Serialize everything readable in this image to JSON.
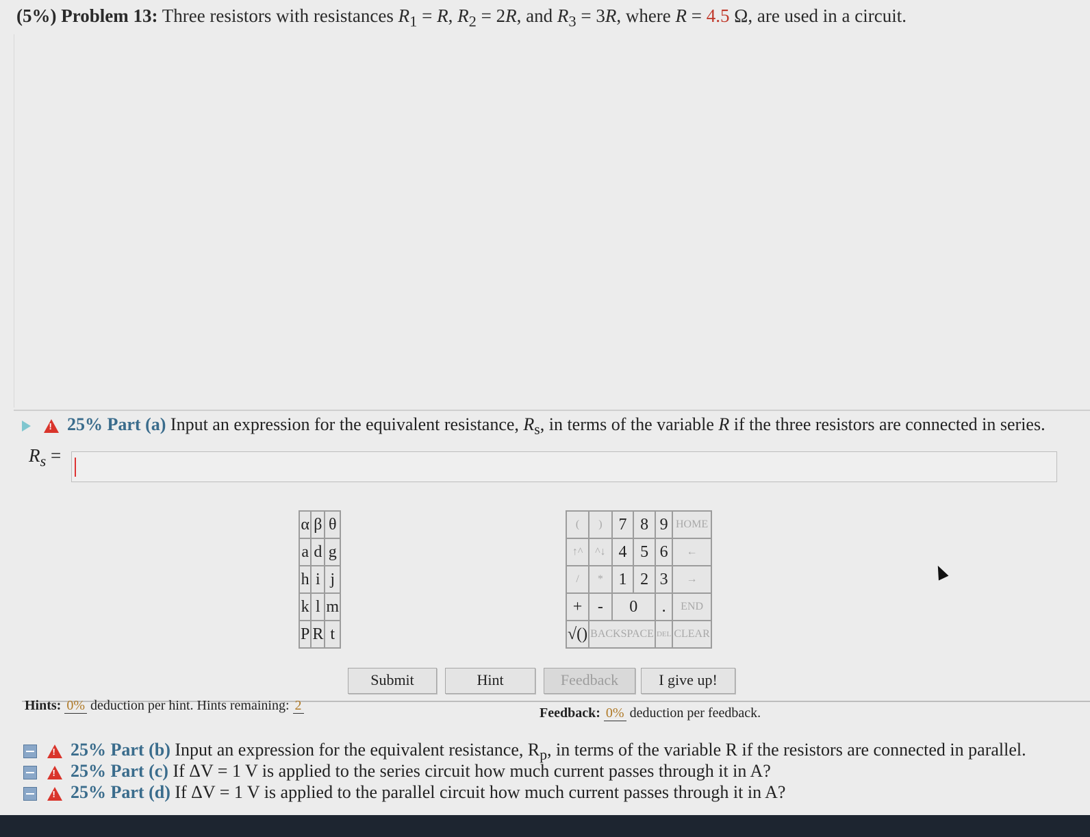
{
  "problem": {
    "pct": "(5%)",
    "title": "Problem 13:",
    "text_a": "Three resistors with resistances ",
    "r1": "R",
    "r1_sub": "1",
    "eq1": " = ",
    "r_var": "R",
    "sep1": ", ",
    "r2": "R",
    "r2_sub": "2",
    "eq2": " = 2",
    "sep2": ", and ",
    "r3": "R",
    "r3_sub": "3",
    "eq3": " = 3",
    "where": ", where ",
    "eq4": " = ",
    "r_value": "4.5",
    "unit": " Ω, are used in a circuit."
  },
  "part_a": {
    "percent": "25%",
    "label": "Part (a)",
    "text_1": "Input an expression for the equivalent resistance, ",
    "rs": "R",
    "rs_sub": "s",
    "text_2": ", in terms of the variable ",
    "var": "R",
    "text_3": " if the three resistors are connected in series.",
    "answer_label": "R",
    "answer_sub": "s",
    "answer_eq": "=",
    "answer_value": ""
  },
  "keypad": {
    "letters": [
      [
        "α",
        "β",
        "θ"
      ],
      [
        "a",
        "d",
        "g"
      ],
      [
        "h",
        "i",
        "j"
      ],
      [
        "k",
        "l",
        "m"
      ],
      [
        "P",
        "R",
        "t"
      ]
    ],
    "numbers": {
      "r1": [
        "(",
        ")",
        "7",
        "8",
        "9",
        "HOME"
      ],
      "r2": [
        "↑^",
        "^↓",
        "4",
        "5",
        "6",
        "←"
      ],
      "r3": [
        "/",
        "*",
        "1",
        "2",
        "3",
        "→"
      ],
      "r4": [
        "+",
        "-",
        "0",
        ".",
        "END"
      ],
      "r5": [
        "√()",
        "BACKSPACE",
        "DEL",
        "CLEAR"
      ]
    }
  },
  "buttons": {
    "submit": "Submit",
    "hint": "Hint",
    "feedback": "Feedback",
    "give_up": "I give up!"
  },
  "hints": {
    "label": "Hints:",
    "pct": "0%",
    "text": "deduction per hint. Hints remaining:",
    "remaining": "2"
  },
  "feedback": {
    "label": "Feedback:",
    "pct": "0%",
    "text": "deduction per feedback."
  },
  "other_parts": [
    {
      "percent": "25%",
      "label": "Part (b)",
      "text": "Input an expression for the equivalent resistance, R",
      "sub": "p",
      "tail": ", in terms of the variable R if the resistors are connected in parallel."
    },
    {
      "percent": "25%",
      "label": "Part (c)",
      "text": "If ΔV = 1 V is applied to the series circuit how much current passes through it in A?",
      "sub": "",
      "tail": ""
    },
    {
      "percent": "25%",
      "label": "Part (d)",
      "text": "If ΔV = 1 V is applied to the parallel circuit how much current passes through it in A?",
      "sub": "",
      "tail": ""
    }
  ],
  "colors": {
    "accent_blue": "#3a6c8c",
    "warning_red": "#d9342b",
    "value_red": "#c0392b"
  }
}
